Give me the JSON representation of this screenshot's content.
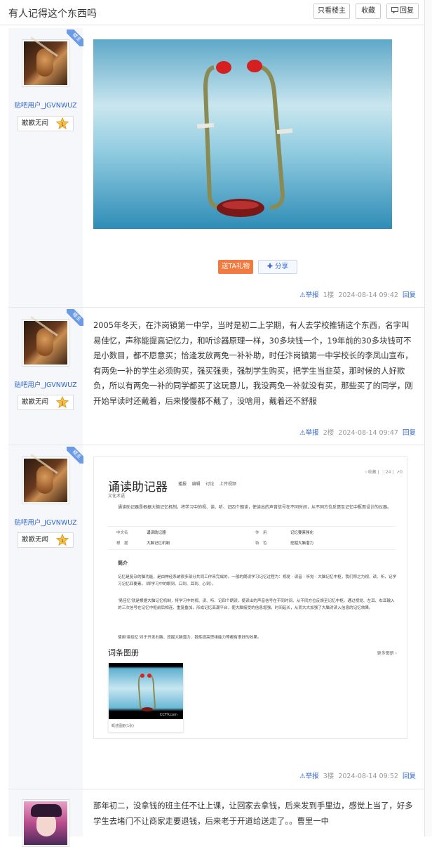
{
  "page": {
    "title": "有人记得这个东西吗",
    "buttons": {
      "only_op": "只看楼主",
      "collect": "收藏",
      "reply": "回复"
    }
  },
  "badge": "楼主",
  "posts": [
    {
      "user": "贴吧用户_JGVNWUZ",
      "level_name": "歉歉无闻",
      "level": "1",
      "gift_label": "送TA礼物",
      "share_label": "分享",
      "footer": {
        "report": "举报",
        "floor": "1楼",
        "time": "2024-08-14 09:42",
        "reply": "回复"
      }
    },
    {
      "user": "贴吧用户_JGVNWUZ",
      "level_name": "歉歉无闻",
      "level": "1",
      "text": "2005年冬天，在汴岗镇第一中学，当时是初二上学期，有人去学校推销这个东西，名字叫易佳忆，声称能提高记忆力，和听诊器原理一样，30多块钱一个，19年前的30多块钱可不是小数目，都不愿意买；恰逢发放两免一补补助，时任汴岗镇第一中学校长的李凤山宣布，有两免一补的学生必须购买，强买强卖，强制学生购买，把学生当韭菜，那时候的人好欺负，所以有两免一补的同学都买了这玩意儿，我没两免一补就没有买，那些买了的同学，刚开始早读时还戴着，后来慢慢都不戴了，没啥用，戴着还不舒服",
      "footer": {
        "report": "举报",
        "floor": "2楼",
        "time": "2024-08-14 09:47",
        "reply": "回复"
      }
    },
    {
      "user": "贴吧用户_JGVNWUZ",
      "level_name": "歉歉无闻",
      "level": "1",
      "footer": {
        "report": "举报",
        "floor": "3楼",
        "time": "2024-08-14 09:52",
        "reply": "回复"
      },
      "screenshot": {
        "heading": "诵读助记器",
        "actions": [
          "播报",
          "编辑",
          "讨论",
          "上传视频"
        ],
        "stats": {
          "collect": "收藏",
          "likes": "24",
          "shares": "0"
        },
        "subtitle": "文化术语",
        "summary": "诵读助记器是根据大脑记忆机制，将学习中的视、读、听、记四个朗读，使读出的声音信号在不同时间，从不同方位反馈至记忆中枢而设计的仪器。",
        "info": [
          {
            "k": "中文名",
            "v": "诵读助记器",
            "k2": "作　用",
            "v2": "记忆要素强化"
          },
          {
            "k": "根　据",
            "v": "大脑记忆机制",
            "k2": "特　色",
            "v2": "挖掘大脑潜力"
          }
        ],
        "section": "简介",
        "paras": [
          "记忆是复杂的脑功能，是由神经系统很多部分共同工作来完成的。一般的朗读学习记忆过程为：视觉 - 读音 - 听觉 - 大脑记忆中枢，我们称之为视、读、听、记学习记忆四要素。（即学习中的眼到、口到、耳到、心到）。",
          "'易佳忆'就是根据大脑记忆机制，将学习中的视、读、听、记四个朗读，使读出的声音信号在不同时间、从不同方位反馈至记忆中枢。通过视觉、左耳、右耳输入的三次信号在记忆中枢前后相连、重复叠加，形成记忆高潮平台，使大脑接受的信息增强，时间延长，从而大大加强了大脑对读入信息的记忆效果。",
          "使用'易佳忆'对于开发右脑、挖掘大脑潜力、锻炼提高思维能力等都有很好的效果。"
        ],
        "album": "词条图册",
        "more": "更多图册",
        "album_caption": "概述图册(1张)",
        "watermark": "CCTV.com"
      }
    },
    {
      "text": "那年初二，没拿钱的班主任不让上课，让回家去拿钱，后来发到手里边，感觉上当了，好多学生去堵门不让商家走要退钱，后来老于开道给送走了。。曹里一中"
    }
  ]
}
